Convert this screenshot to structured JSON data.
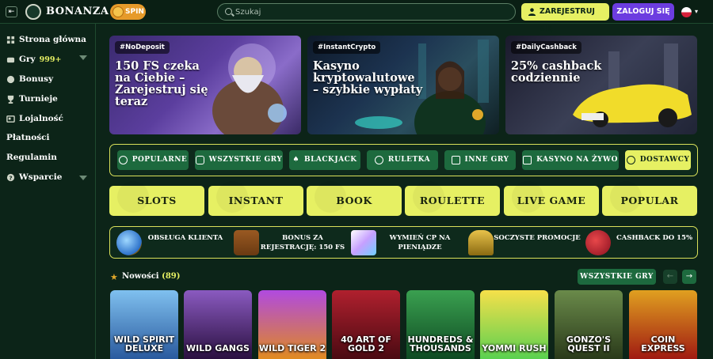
{
  "topbar": {
    "brand": "BONANZA",
    "spin_label": "SPIN",
    "search_placeholder": "Szukaj",
    "register_label": "ZAREJESTRUJ SIĘ",
    "login_label": "ZALOGUJ SIĘ",
    "language_icon": "poland-flag-icon"
  },
  "sidebar": {
    "items": [
      {
        "label": "Strona główna",
        "icon": "home-icon"
      },
      {
        "label": "Gry",
        "badge": "999+",
        "icon": "games-icon"
      },
      {
        "label": "Bonusy",
        "icon": "bonus-icon"
      },
      {
        "label": "Turnieje",
        "icon": "trophy-icon"
      },
      {
        "label": "Lojalność",
        "icon": "loyalty-icon"
      },
      {
        "label": "Płatności"
      },
      {
        "label": "Regulamin"
      },
      {
        "label": "Wsparcie",
        "icon": "help-icon"
      }
    ]
  },
  "banners": [
    {
      "tag": "#NoDeposit",
      "title": "150 FS czeka na Ciebie – Zarejestruj się teraz"
    },
    {
      "tag": "#InstantCrypto",
      "title": "Kasyno kryptowalutowe – szybkie wypłaty"
    },
    {
      "tag": "#DailyCashback",
      "title": "25% cashback codziennie"
    }
  ],
  "filters": [
    {
      "label": "POPULARNE",
      "icon": "popular-icon"
    },
    {
      "label": "WSZYSTKIE GRY",
      "icon": "gamepad-icon"
    },
    {
      "label": "BLACKJACK",
      "icon": "spade-icon"
    },
    {
      "label": "RULETKA",
      "icon": "roulette-icon"
    },
    {
      "label": "INNE GRY",
      "icon": "other-games-icon"
    },
    {
      "label": "KASYNO NA ŻYWO",
      "icon": "live-icon"
    },
    {
      "label": "DOSTAWCY",
      "icon": "providers-icon",
      "active": true
    }
  ],
  "categories": [
    "SLOTS",
    "INSTANT",
    "BOOK",
    "ROULETTE",
    "LIVE GAME",
    "POPULAR"
  ],
  "info": [
    {
      "text": "OBSŁUGA KLIENTA",
      "icon": "crystal-ball-icon"
    },
    {
      "text": "BONUS ZA REJESTRACJĘ: 150 FS",
      "icon": "treasure-chest-icon"
    },
    {
      "text": "WYMIEŃ CP NA PIENIĄDZE",
      "icon": "diamond-icon"
    },
    {
      "text": "SOCZYSTE PROMOCJE",
      "icon": "magic-lamp-icon"
    },
    {
      "text": "CASHBACK DO 15%",
      "icon": "money-bag-icon"
    }
  ],
  "new_games": {
    "title": "Nowości",
    "count": "(89)",
    "all_label": "WSZYSTKIE GRY",
    "games": [
      {
        "title": "WILD SPIRIT DELUXE",
        "color": "#3f8fd6"
      },
      {
        "title": "WILD GANGS",
        "color": "#5a2d7a"
      },
      {
        "title": "WILD TIGER 2",
        "color": "#8a2fc9"
      },
      {
        "title": "40 ART OF GOLD 2",
        "color": "#8a1525"
      },
      {
        "title": "HUNDREDS & THOUSANDS",
        "color": "#1f7a3a"
      },
      {
        "title": "YOMMI RUSH",
        "color": "#f2d12a"
      },
      {
        "title": "GONZO'S QUEST II",
        "color": "#3e5a2a"
      },
      {
        "title": "COIN EXPRESS",
        "color": "#c9301e"
      }
    ]
  }
}
